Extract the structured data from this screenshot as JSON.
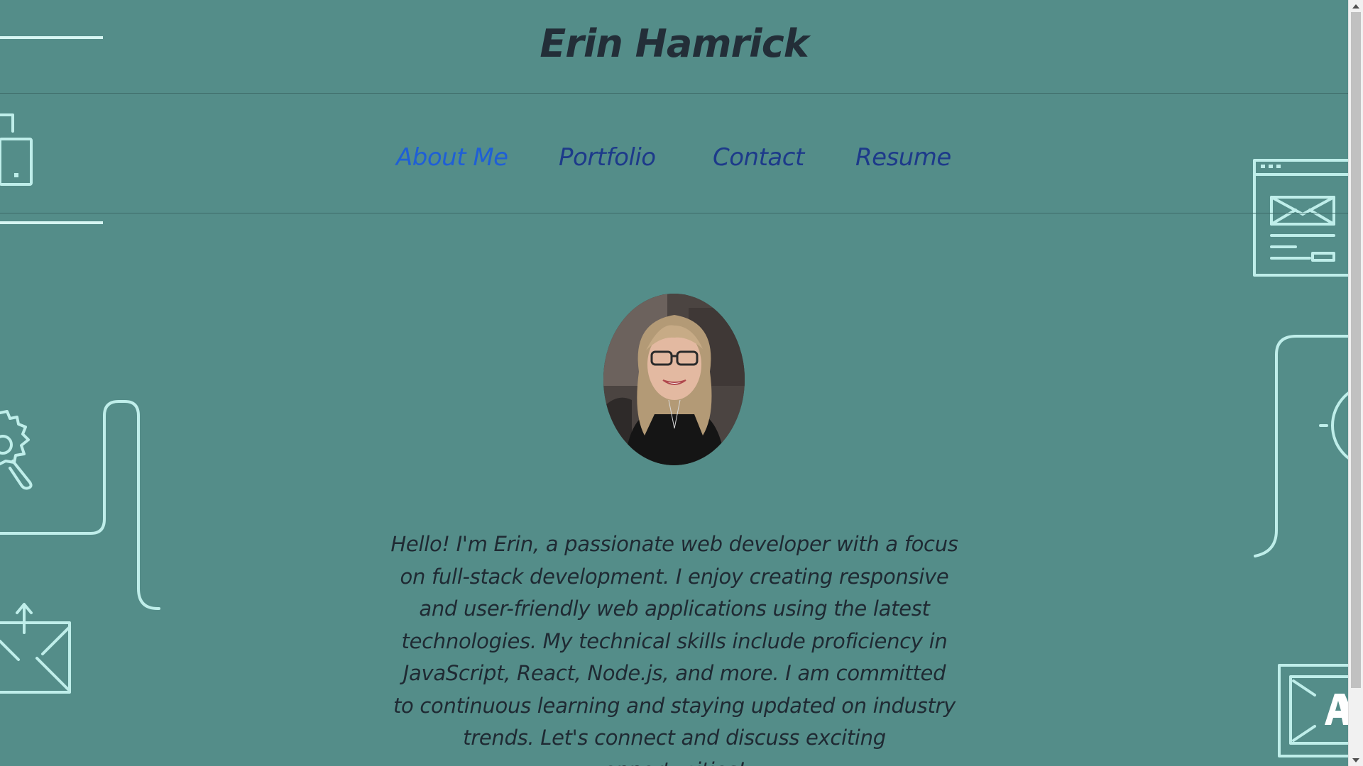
{
  "header": {
    "title": "Erin Hamrick"
  },
  "nav": {
    "items": [
      {
        "label": "About Me",
        "active": true
      },
      {
        "label": "Portfolio",
        "active": false
      },
      {
        "label": "Contact",
        "active": false
      },
      {
        "label": "Resume",
        "active": false
      }
    ]
  },
  "about": {
    "photo_alt": "Erin Hamrick profile photo",
    "text": "Hello! I'm Erin, a passionate web developer with a focus on full-stack development. I enjoy creating responsive and user-friendly web applications using the latest technologies. My technical skills include proficiency in JavaScript, React, Node.js, and more. I am committed to continuous learning and staying updated on industry trends. Let's connect and discuss exciting opportunities!"
  },
  "background": {
    "icons": [
      "mobile-phone-icon",
      "gear-search-icon",
      "mail-upload-icon",
      "browser-mail-icon",
      "target-icon",
      "browser-ad-icon"
    ]
  },
  "colors": {
    "page_background": "#548d89",
    "title_text": "#232e38",
    "nav_link": "#1d3a8a",
    "nav_link_active": "#1f5fd6",
    "body_text": "#1f2a33",
    "decor_line": "#bfeeea"
  }
}
